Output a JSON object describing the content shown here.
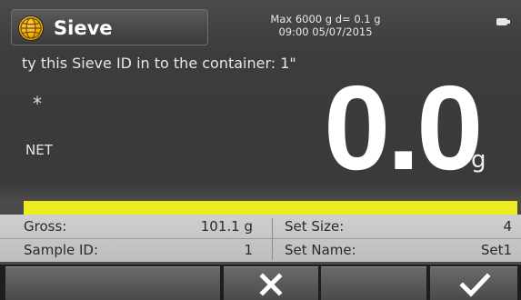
{
  "header": {
    "title": "Sieve",
    "max_capacity": "Max 6000 g  d= 0.1 g",
    "datetime": "09:00   05/07/2015",
    "globe_icon": "globe-icon",
    "battery_icon": "battery-icon"
  },
  "prompt": "ty this Sieve ID in to the container: 1\"",
  "indicators": {
    "stable": "*",
    "mode": "NET"
  },
  "reading": {
    "value": "0.0",
    "unit": "g"
  },
  "capacity_bar": {
    "fill_fraction": 1.0,
    "color": "#ECEC1E"
  },
  "info": {
    "gross_label": "Gross:",
    "gross_value": "101.1 g",
    "sample_id_label": "Sample ID:",
    "sample_id_value": "1",
    "set_size_label": "Set Size:",
    "set_size_value": "4",
    "set_name_label": "Set Name:",
    "set_name_value": "Set1"
  },
  "buttons": {
    "cancel_icon": "close-icon",
    "confirm_icon": "checkmark-icon"
  }
}
